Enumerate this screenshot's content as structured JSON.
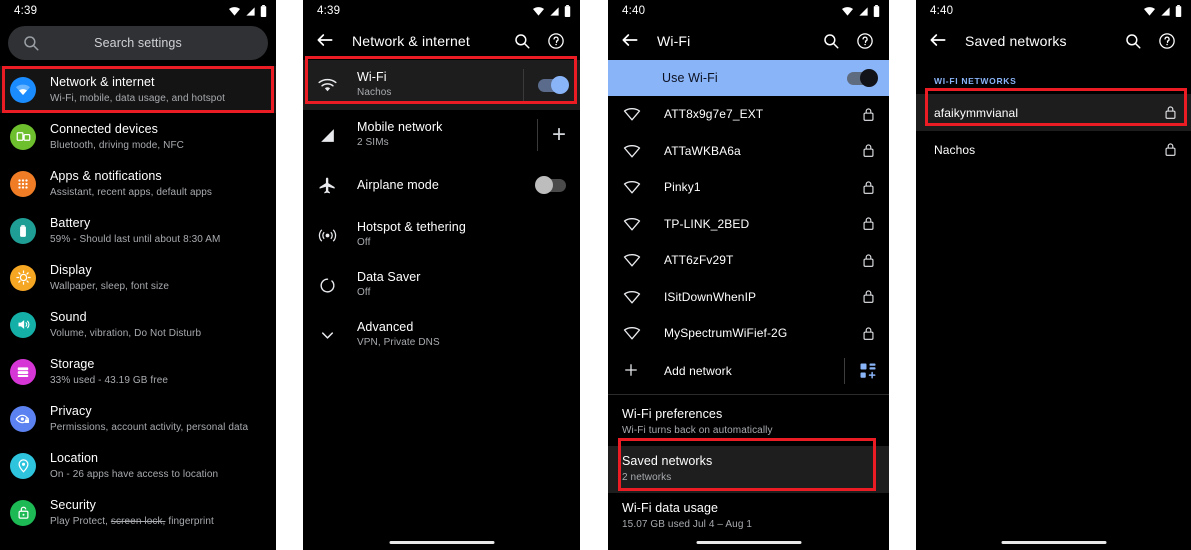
{
  "panels": {
    "settings": {
      "status": {
        "time": "4:39",
        "icons": [
          "wifi-icon",
          "signal-icon",
          "battery-icon"
        ]
      },
      "search": {
        "placeholder": "Search settings",
        "icon": "search-icon"
      },
      "items": [
        {
          "title": "Network & internet",
          "sub": "Wi-Fi, mobile, data usage, and hotspot",
          "icon": "wifi-icon",
          "color": "#1a8cff",
          "highlighted": true
        },
        {
          "title": "Connected devices",
          "sub": "Bluetooth, driving mode, NFC",
          "icon": "devices-icon",
          "color": "#6dbf2e",
          "highlighted": false
        },
        {
          "title": "Apps & notifications",
          "sub": "Assistant, recent apps, default apps",
          "icon": "apps-grid-icon",
          "color": "#f07c26",
          "highlighted": false
        },
        {
          "title": "Battery",
          "sub": "59% - Should last until about 8:30 AM",
          "icon": "battery-icon",
          "color": "#1e9e95",
          "highlighted": false
        },
        {
          "title": "Display",
          "sub": "Wallpaper, sleep, font size",
          "icon": "brightness-icon",
          "color": "#f5a623",
          "highlighted": false
        },
        {
          "title": "Sound",
          "sub": "Volume, vibration, Do Not Disturb",
          "icon": "volume-icon",
          "color": "#14b0a8",
          "highlighted": false
        },
        {
          "title": "Storage",
          "sub": "33% used - 43.19 GB free",
          "icon": "storage-icon",
          "color": "#d636d6",
          "highlighted": false
        },
        {
          "title": "Privacy",
          "sub": "Permissions, account activity, personal data",
          "icon": "privacy-eye-icon",
          "color": "#5b82f0",
          "highlighted": false
        },
        {
          "title": "Location",
          "sub": "On - 26 apps have access to location",
          "icon": "location-pin-icon",
          "color": "#2ec4dd",
          "highlighted": false
        },
        {
          "title": "Security",
          "sub_pre": "Play Protect, ",
          "sub_strike": "screen lock,",
          "sub_post": " fingerprint",
          "icon": "unlock-icon",
          "color": "#1db954",
          "highlighted": false
        }
      ]
    },
    "network": {
      "status": {
        "time": "4:39"
      },
      "appbar": {
        "title": "Network & internet",
        "back": "back-arrow-icon",
        "icons": [
          "search-icon",
          "help-icon"
        ]
      },
      "items": [
        {
          "title": "Wi-Fi",
          "sub": "Nachos",
          "icon": "wifi-icon",
          "tail": "toggle-on",
          "highlighted": true
        },
        {
          "title": "Mobile network",
          "sub": "2 SIMs",
          "icon": "signal-icon",
          "tail": "plus",
          "highlighted": false
        },
        {
          "title": "Airplane mode",
          "sub": "",
          "icon": "airplane-icon",
          "tail": "toggle-off",
          "highlighted": false
        },
        {
          "title": "Hotspot & tethering",
          "sub": "Off",
          "icon": "hotspot-icon",
          "tail": "none",
          "highlighted": false
        },
        {
          "title": "Data Saver",
          "sub": "Off",
          "icon": "data-saver-icon",
          "tail": "none",
          "highlighted": false
        },
        {
          "title": "Advanced",
          "sub": "VPN, Private DNS",
          "icon": "chevron-down-icon",
          "tail": "none",
          "highlighted": false
        }
      ]
    },
    "wifi": {
      "status": {
        "time": "4:40"
      },
      "appbar": {
        "title": "Wi-Fi",
        "back": "back-arrow-icon",
        "icons": [
          "search-icon",
          "help-icon"
        ]
      },
      "use_wifi": {
        "label": "Use Wi-Fi",
        "state": "on"
      },
      "networks": [
        {
          "name": "ATT8x9g7e7_EXT",
          "secured": true
        },
        {
          "name": "ATTaWKBA6a",
          "secured": true
        },
        {
          "name": "Pinky1",
          "secured": true
        },
        {
          "name": "TP-LINK_2BED",
          "secured": true
        },
        {
          "name": "ATT6zFv29T",
          "secured": true
        },
        {
          "name": "ISitDownWhenIP",
          "secured": true
        },
        {
          "name": "MySpectrumWiFief-2G",
          "secured": true
        }
      ],
      "add_network": {
        "label": "Add network",
        "icon": "plus-icon",
        "qr": "qr-scan-icon"
      },
      "prefs": [
        {
          "title": "Wi-Fi preferences",
          "sub": "Wi-Fi turns back on automatically",
          "highlighted": false
        },
        {
          "title": "Saved networks",
          "sub": "2 networks",
          "highlighted": true
        },
        {
          "title": "Wi-Fi data usage",
          "sub": "15.07 GB used Jul 4 – Aug 1",
          "highlighted": false
        }
      ]
    },
    "saved": {
      "status": {
        "time": "4:40"
      },
      "appbar": {
        "title": "Saved networks",
        "back": "back-arrow-icon",
        "icons": [
          "search-icon",
          "help-icon"
        ]
      },
      "section_header": "WI-FI NETWORKS",
      "networks": [
        {
          "name": "afaikymmvianal",
          "secured": true,
          "highlighted": true
        },
        {
          "name": "Nachos",
          "secured": true,
          "highlighted": false
        }
      ]
    }
  },
  "colors": {
    "annotation": "#ec1c24",
    "accent": "#8ab4f8",
    "background": "#000000",
    "gap": "#ffffff"
  }
}
